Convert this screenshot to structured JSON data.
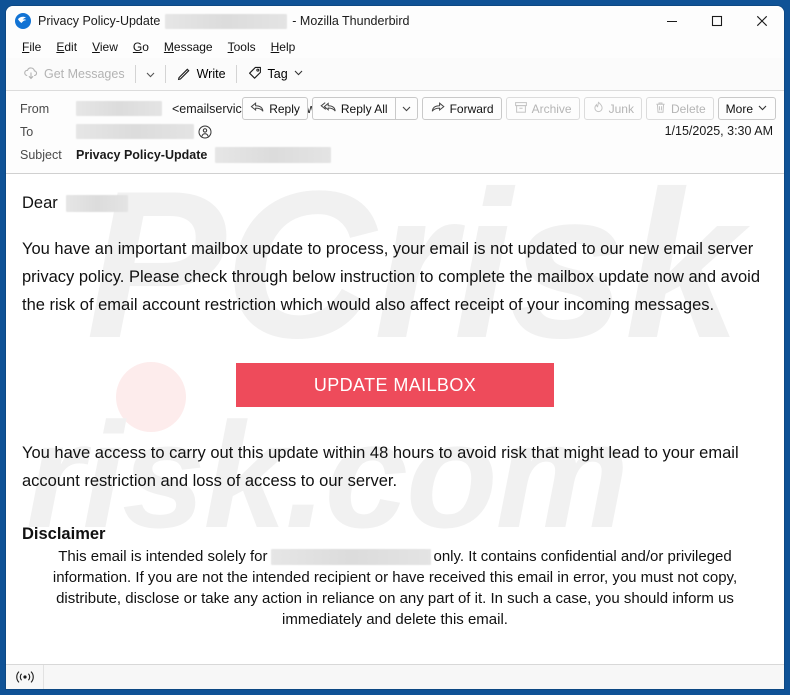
{
  "window": {
    "title_prefix": "Privacy Policy-Update",
    "title_suffix": "- Mozilla Thunderbird",
    "app_icon": "thunderbird-icon",
    "controls": {
      "minimize": "minimize-icon",
      "maximize": "maximize-icon",
      "close": "close-icon"
    }
  },
  "menu": {
    "items": [
      {
        "label": "File",
        "accel": "F"
      },
      {
        "label": "Edit",
        "accel": "E"
      },
      {
        "label": "View",
        "accel": "V"
      },
      {
        "label": "Go",
        "accel": "G"
      },
      {
        "label": "Message",
        "accel": "M"
      },
      {
        "label": "Tools",
        "accel": "T"
      },
      {
        "label": "Help",
        "accel": "H"
      }
    ]
  },
  "toolbar": {
    "get_messages": "Get Messages",
    "write": "Write",
    "tag": "Tag"
  },
  "header": {
    "from_label": "From",
    "from_address": "<emailservice@servertown.ch>",
    "to_label": "To",
    "subject_label": "Subject",
    "subject_value": "Privacy Policy-Update",
    "date": "1/15/2025, 3:30 AM"
  },
  "actions": {
    "reply": "Reply",
    "reply_all": "Reply All",
    "forward": "Forward",
    "archive": "Archive",
    "junk": "Junk",
    "delete": "Delete",
    "more": "More"
  },
  "message": {
    "greeting": "Dear",
    "paragraph1": "You have an important mailbox update to process, your email is not updated to our new email server privacy policy. Please check through below instruction to complete the mailbox update now and avoid the risk of email account restriction which would also affect receipt of your incoming messages.",
    "cta_label": "UPDATE MAILBOX",
    "cta_color": "#ee4b5b",
    "paragraph2": "You have access to carry out this update within 48 hours to avoid risk that might lead to your email account restriction and loss of access to our server.",
    "disclaimer_title": "Disclaimer",
    "disclaimer_part1": "This email is intended solely for",
    "disclaimer_part2": "only. It contains confidential and/or privileged information. If you are not the intended recipient or have received this email in error, you must not copy, distribute, disclose or take any action in reliance on any part of it. In such a case, you should inform us immediately and delete this email.",
    "watermark1": "PCrisk",
    "watermark2": "risk.com"
  },
  "status": {
    "online_icon": "online-indicator-icon",
    "text": ""
  }
}
